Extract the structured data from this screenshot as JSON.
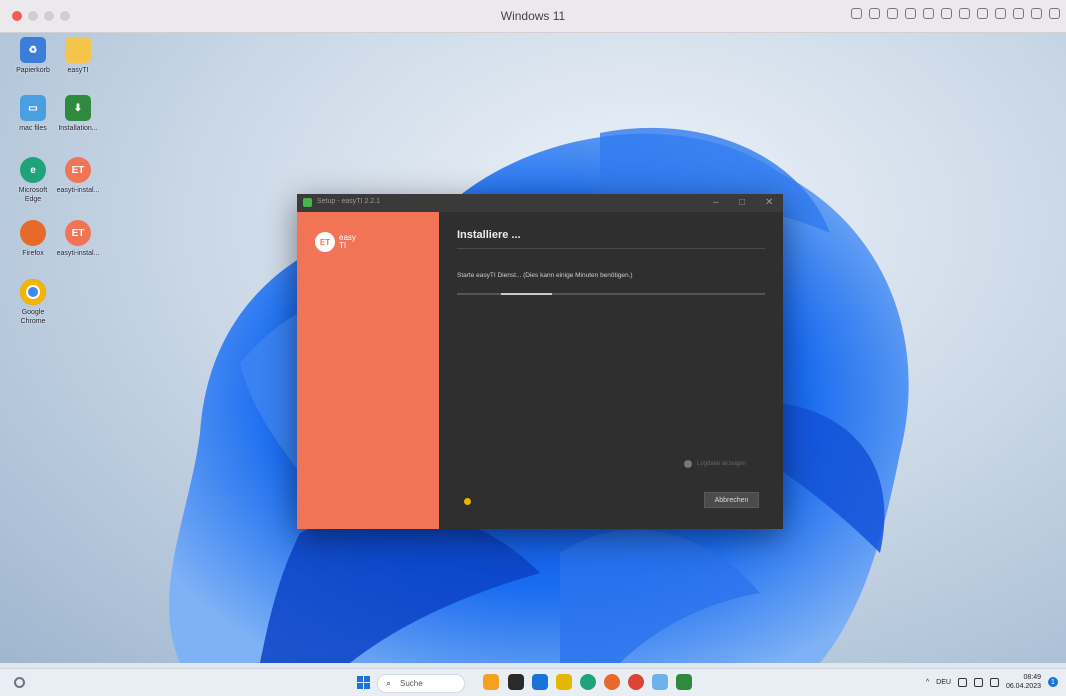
{
  "host": {
    "title": "Windows 11",
    "traffic_lights": [
      "#f35d57",
      "#cfcfcf",
      "#cfcfcf",
      "#cfcfcf"
    ]
  },
  "desktop_icons": [
    {
      "label": "Papierkorb",
      "icon": "recycle-bin-icon",
      "color": "#3b7dd8"
    },
    {
      "label": "easyTI",
      "icon": "folder-icon",
      "color": "#f4c54a"
    },
    {
      "label": "mac files",
      "icon": "mac-files-icon",
      "color": "#4a9fe0"
    },
    {
      "label": "Installation...",
      "icon": "installer-icon",
      "color": "#2f8a3f"
    },
    {
      "label": "Microsoft Edge",
      "icon": "edge-icon",
      "color": "#1fa37a"
    },
    {
      "label": "easyti-instal...",
      "icon": "easyti-installer-icon",
      "color": "#f27456"
    },
    {
      "label": "Firefox",
      "icon": "firefox-icon",
      "color": "#e86a2b"
    },
    {
      "label": "easyti-instal...",
      "icon": "easyti-installer-icon",
      "color": "#f27456"
    },
    {
      "label": "Google Chrome",
      "icon": "chrome-icon",
      "color": "#db4437"
    }
  ],
  "installer": {
    "window_title": "Setup - easyTI 2.2.1",
    "logo_mark": "ET",
    "logo_word1": "easy",
    "logo_word2": "TI",
    "heading": "Installiere ...",
    "status": "Starte easyTI Dienst... (Dies kann einige Minuten benötigen.)",
    "progress": 0.3,
    "checkbox_label": "Logdatei anzeigen",
    "cancel_label": "Abbrechen",
    "accent": "#f27456",
    "spinner_color": "#e2b800"
  },
  "taskbar": {
    "search_placeholder": "Suche",
    "apps": [
      "explorer-icon",
      "chat-icon",
      "files-icon",
      "edge-icon",
      "firefox-icon",
      "chrome-icon",
      "store-icon",
      "installer-icon"
    ],
    "tray_chevron": "^",
    "lang": "DEU",
    "time": "08:49",
    "date": "06.04.2023",
    "notification_count": "1"
  }
}
